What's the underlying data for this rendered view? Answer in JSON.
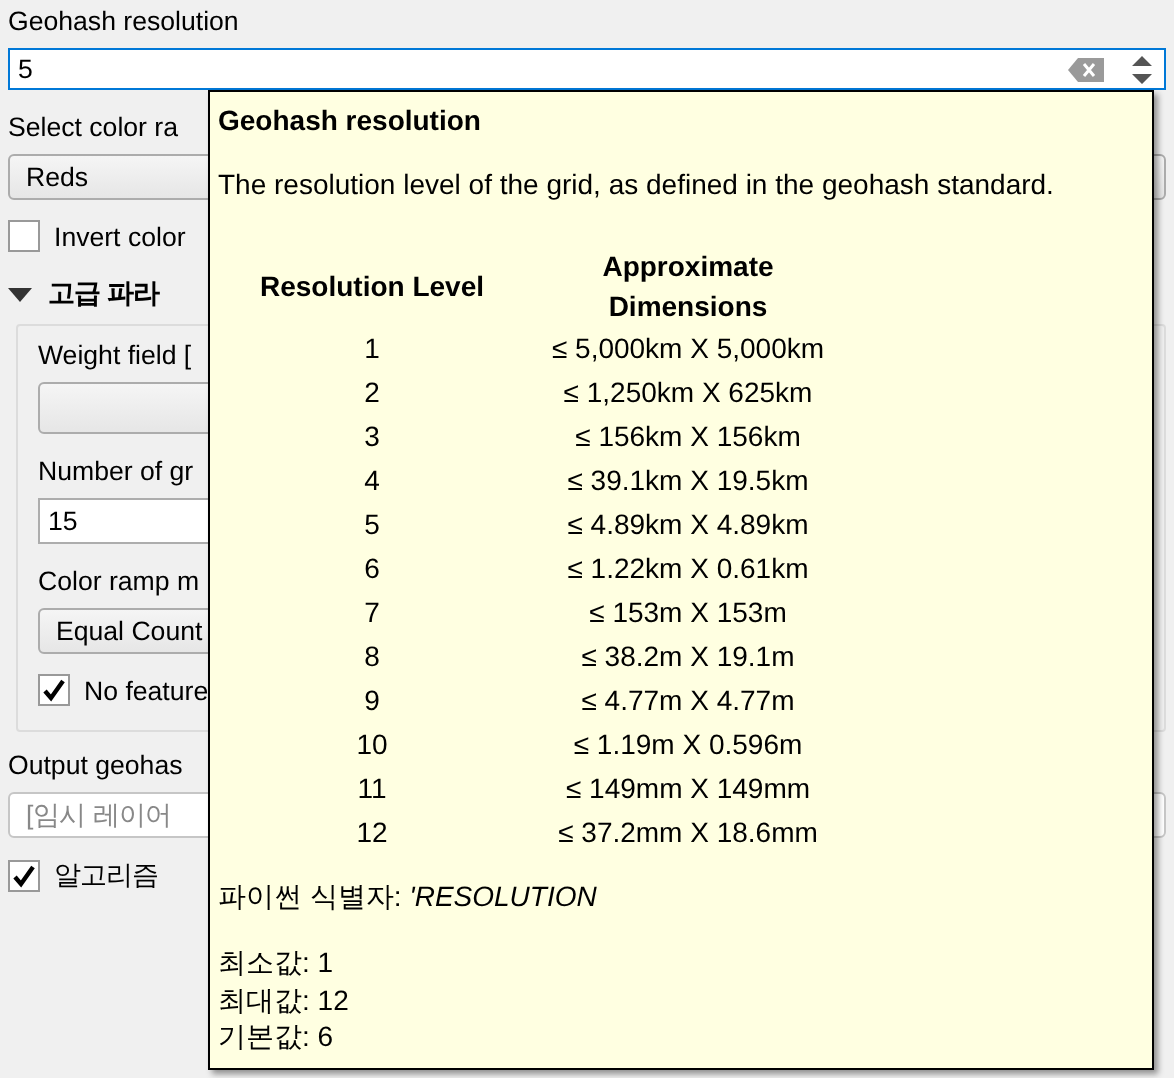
{
  "form": {
    "resolution_label": "Geohash resolution",
    "resolution_value": "5",
    "color_ramp_label": "Select color ra",
    "color_ramp_value": "Reds",
    "invert": {
      "label": "Invert color",
      "checked": false
    },
    "advanced": {
      "label": "고급 파라",
      "expanded": true,
      "weight_label": "Weight field [",
      "grid_label": "Number of gr",
      "grid_value": "15",
      "ramp_mode_label": "Color ramp m",
      "ramp_mode_value": "Equal Count",
      "no_feature": {
        "label": "No feature",
        "checked": true
      }
    },
    "output_label": "Output geohas",
    "output_placeholder": "[임시 레이어",
    "open_after": {
      "label": "알고리즘",
      "checked": true
    }
  },
  "tooltip": {
    "title": "Geohash resolution",
    "description": "The resolution level of the grid, as defined in the geohash standard.",
    "columns": [
      "Resolution Level",
      "Approximate Dimensions"
    ],
    "rows": [
      {
        "level": "1",
        "dimensions": "≤ 5,000km X 5,000km"
      },
      {
        "level": "2",
        "dimensions": "≤ 1,250km X 625km"
      },
      {
        "level": "3",
        "dimensions": "≤ 156km X 156km"
      },
      {
        "level": "4",
        "dimensions": "≤ 39.1km X 19.5km"
      },
      {
        "level": "5",
        "dimensions": "≤ 4.89km X 4.89km"
      },
      {
        "level": "6",
        "dimensions": "≤ 1.22km X 0.61km"
      },
      {
        "level": "7",
        "dimensions": "≤ 153m X 153m"
      },
      {
        "level": "8",
        "dimensions": "≤ 38.2m X 19.1m"
      },
      {
        "level": "9",
        "dimensions": "≤ 4.77m X 4.77m"
      },
      {
        "level": "10",
        "dimensions": "≤ 1.19m X 0.596m"
      },
      {
        "level": "11",
        "dimensions": "≤ 149mm X 149mm"
      },
      {
        "level": "12",
        "dimensions": "≤ 37.2mm X 18.6mm"
      }
    ],
    "python_id": "파이썬 식별자: *'RESOLUTION*",
    "limits": [
      "최소값: 1",
      "최대값: 12",
      "기본값: 6"
    ]
  }
}
